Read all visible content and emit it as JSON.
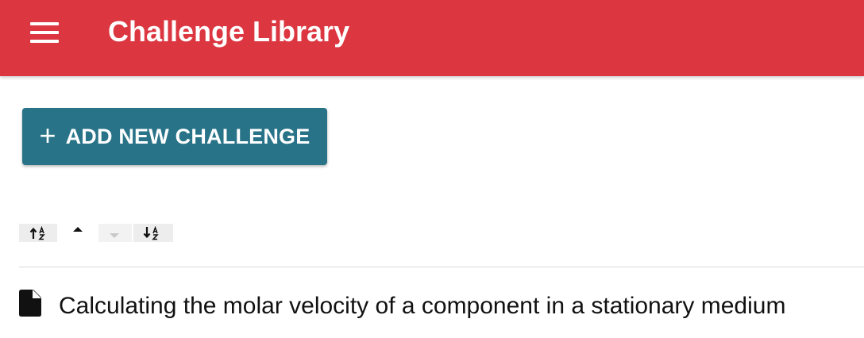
{
  "appbar": {
    "title": "Challenge Library",
    "menu_icon": "hamburger-menu-icon",
    "background_color": "#dc3640"
  },
  "add_button": {
    "icon": "plus-icon",
    "plus_glyph": "+",
    "label": "ADD NEW CHALLENGE",
    "background_color": "#287388"
  },
  "sort_controls": [
    {
      "name": "sort-ascending-az-icon"
    },
    {
      "name": "move-up-icon"
    },
    {
      "name": "move-down-icon"
    },
    {
      "name": "sort-descending-az-icon"
    }
  ],
  "challenges": [
    {
      "icon": "document-icon",
      "title": "Calculating the molar velocity of a component in a stationary medium"
    }
  ]
}
